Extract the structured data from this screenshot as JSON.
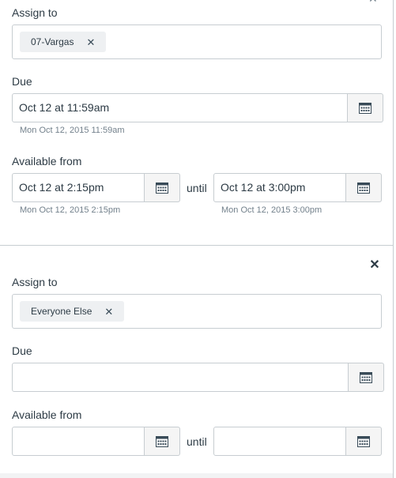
{
  "sections": [
    {
      "assign_label": "Assign to",
      "assignee": "07-Vargas",
      "due_label": "Due",
      "due_value": "Oct 12 at 11:59am",
      "due_hint": "Mon Oct 12, 2015 11:59am",
      "available_label": "Available from",
      "from_value": "Oct 12 at 2:15pm",
      "from_hint": "Mon Oct 12, 2015 2:15pm",
      "until_label": "until",
      "until_value": "Oct 12 at 3:00pm",
      "until_hint": "Mon Oct 12, 2015 3:00pm"
    },
    {
      "assign_label": "Assign to",
      "assignee": "Everyone Else",
      "due_label": "Due",
      "due_value": "",
      "available_label": "Available from",
      "from_value": "",
      "until_label": "until",
      "until_value": ""
    }
  ],
  "icons": {
    "remove": "close-icon",
    "calendar": "calendar-icon"
  },
  "colors": {
    "border": "#c7cdd1",
    "token_bg": "#eef0f2",
    "hint_text": "#73818c",
    "text": "#2d3b45"
  }
}
